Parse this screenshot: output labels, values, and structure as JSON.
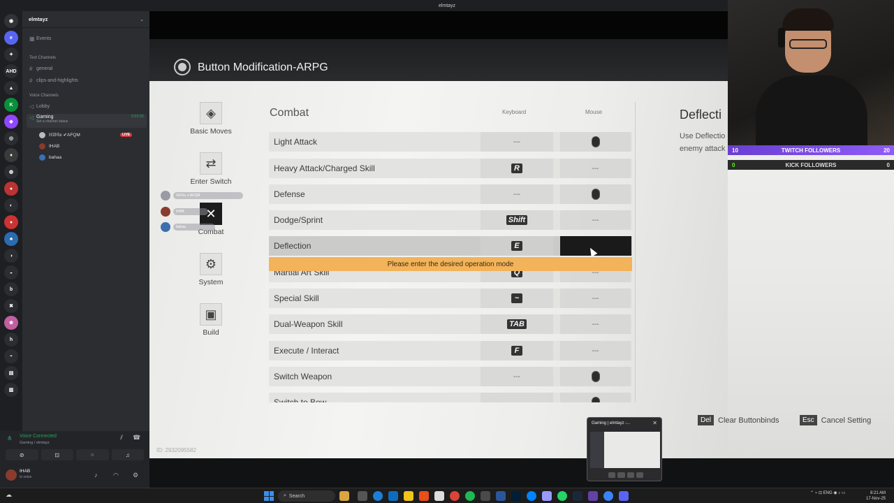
{
  "window": {
    "title": "elmtayz"
  },
  "discord": {
    "server_name": "elmtayz",
    "events": "Events",
    "text_category": "Text Channels",
    "text_channels": [
      "general",
      "clips-and-highlights"
    ],
    "voice_category": "Voice Channels",
    "voice_channels": [
      "Lobby",
      "Gaming"
    ],
    "gaming_status": "Set a channel status",
    "gaming_time": "0:53:55",
    "members": [
      {
        "name": "ℍ𝕀𝕄𝕖 ✔AFQM",
        "live": "LIVE"
      },
      {
        "name": "IHAB"
      },
      {
        "name": "bahaa"
      }
    ],
    "server_badges": [
      "AHD",
      "h",
      "b"
    ],
    "voice_connected": "Voice Connected",
    "voice_connected_sub": "Gaming / elmtayz",
    "user_name": "IHAB",
    "user_status": "In voice"
  },
  "game": {
    "title": "Button Modification-ARPG",
    "categories": [
      {
        "label": "Basic Moves",
        "icon": "◈"
      },
      {
        "label": "Enter Switch",
        "icon": "⇄"
      },
      {
        "label": "Combat",
        "icon": "✕"
      },
      {
        "label": "System",
        "icon": "⚙"
      },
      {
        "label": "Build",
        "icon": "▣"
      }
    ],
    "section_title": "Combat",
    "col_keyboard": "Keyboard",
    "col_mouse": "Mouse",
    "rows": [
      {
        "label": "Light Attack",
        "keyboard": "---",
        "mouse": "mouse-left-icon"
      },
      {
        "label": "Heavy Attack/Charged Skill",
        "keyboard": "R",
        "mouse": "---"
      },
      {
        "label": "Defense",
        "keyboard": "---",
        "mouse": "mouse-right-icon"
      },
      {
        "label": "Dodge/Sprint",
        "keyboard": "Shift",
        "mouse": "---"
      },
      {
        "label": "Deflection",
        "keyboard": "E",
        "mouse": ""
      },
      {
        "label": "Martial Art Skill",
        "keyboard": "Q",
        "mouse": "---"
      },
      {
        "label": "Special Skill",
        "keyboard": "~",
        "mouse": "---"
      },
      {
        "label": "Dual-Weapon Skill",
        "keyboard": "TAB",
        "mouse": "---"
      },
      {
        "label": "Execute / Interact",
        "keyboard": "F",
        "mouse": "---"
      },
      {
        "label": "Switch Weapon",
        "keyboard": "---",
        "mouse": "mouse-wheel-icon"
      },
      {
        "label": "Switch to Bow",
        "keyboard": "",
        "mouse": "mouse-wheel-icon"
      }
    ],
    "hint": "Please enter the desired operation mode",
    "side_title": "Deflecti",
    "side_desc": "Use Deflectio enemy attack",
    "footer": [
      {
        "key": "Del",
        "label": "Clear Buttonbinds"
      },
      {
        "key": "Esc",
        "label": "Cancel Setting"
      }
    ],
    "uid": "ID: 2932095582"
  },
  "stream": {
    "twitch": {
      "count_left": "10",
      "label": "TWITCH FOLLOWERS",
      "count_right": "20"
    },
    "kick": {
      "count_left": "0",
      "label": "KICK FOLLOWERS",
      "count_right": "0"
    }
  },
  "preview": {
    "title": "Gaming | elmtayz -..."
  },
  "taskbar": {
    "search": "Search",
    "lang": "ENG",
    "time": "8:21 AM",
    "date": "17-Nov-25"
  },
  "colors": {
    "twitch": "#8f5cf7",
    "hint": "#f2b35a",
    "accent_green": "#23a55a"
  }
}
